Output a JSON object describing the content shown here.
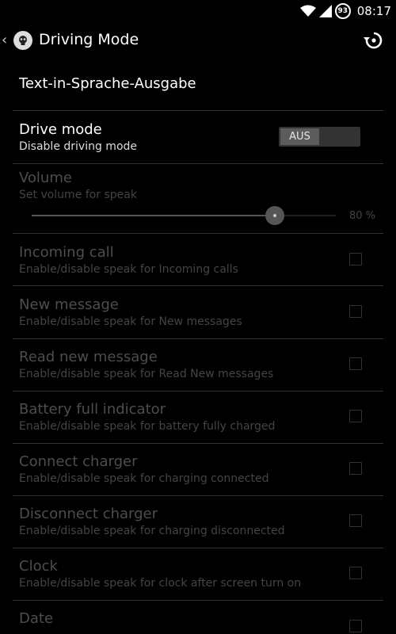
{
  "status_bar": {
    "time": "08:17",
    "battery_level": "93",
    "icons": [
      "wifi-icon",
      "signal-icon",
      "battery-icon"
    ]
  },
  "action_bar": {
    "title": "Driving Mode",
    "back_icon": "chevron-left-icon",
    "app_icon": "skull-icon",
    "action_icon": "reset-icon"
  },
  "category": {
    "title": "Text-in-Sprache-Ausgabe"
  },
  "drive_mode": {
    "title": "Drive mode",
    "summary": "Disable driving mode",
    "toggle_label": "AUS",
    "toggle_on": false
  },
  "volume": {
    "title": "Volume",
    "summary": "Set volume for speak",
    "value": 80,
    "value_label": "80 %"
  },
  "items": [
    {
      "title": "Incoming call",
      "summary": "Enable/disable speak for Incoming calls",
      "checked": false
    },
    {
      "title": "New message",
      "summary": "Enable/disable speak for New messages",
      "checked": false
    },
    {
      "title": "Read new message",
      "summary": "Enable/disable speak for Read New messages",
      "checked": false
    },
    {
      "title": "Battery full indicator",
      "summary": "Enable/disable speak for battery fully charged",
      "checked": false
    },
    {
      "title": "Connect charger",
      "summary": "Enable/disable speak for charging connected",
      "checked": false
    },
    {
      "title": "Disconnect charger",
      "summary": "Enable/disable speak for charging disconnected",
      "checked": false
    },
    {
      "title": "Clock",
      "summary": "Enable/disable speak for clock after screen turn on",
      "checked": false
    },
    {
      "title": "Date",
      "summary": "",
      "checked": false
    }
  ],
  "colors": {
    "background": "#000000",
    "enabled_text": "#ffffff",
    "disabled_text": "#4d4d4d",
    "divider": "#333333"
  }
}
